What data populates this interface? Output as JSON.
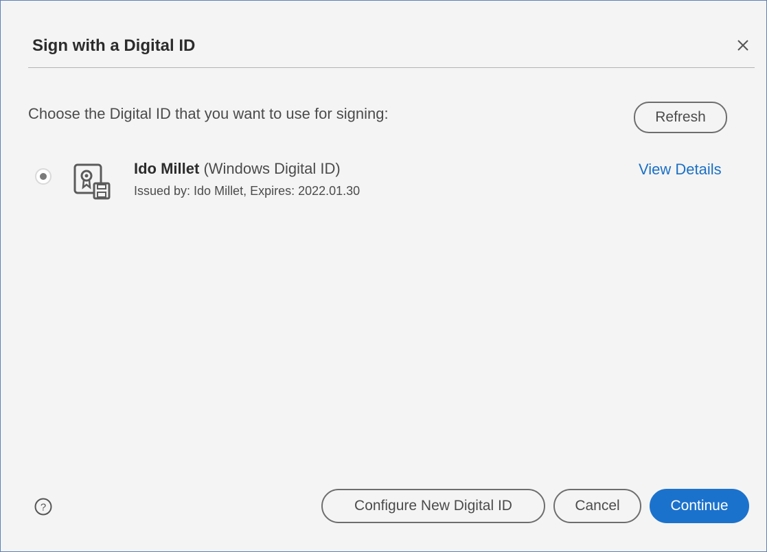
{
  "dialog": {
    "title": "Sign with a Digital ID",
    "prompt": "Choose the Digital ID that you want to use for signing:",
    "refresh_label": "Refresh",
    "close_icon": "close-icon",
    "help_icon": "help-icon"
  },
  "digital_ids": [
    {
      "selected": true,
      "name": "Ido Millet",
      "type": " (Windows Digital ID)",
      "issued": "Issued by: Ido Millet, Expires: 2022.01.30",
      "view_details_label": "View Details",
      "icon": "certificate-icon"
    }
  ],
  "footer": {
    "configure_label": "Configure New Digital ID",
    "cancel_label": "Cancel",
    "continue_label": "Continue"
  },
  "colors": {
    "accent": "#1b72cd",
    "link": "#1a6fc6",
    "background": "#f4f4f4"
  }
}
